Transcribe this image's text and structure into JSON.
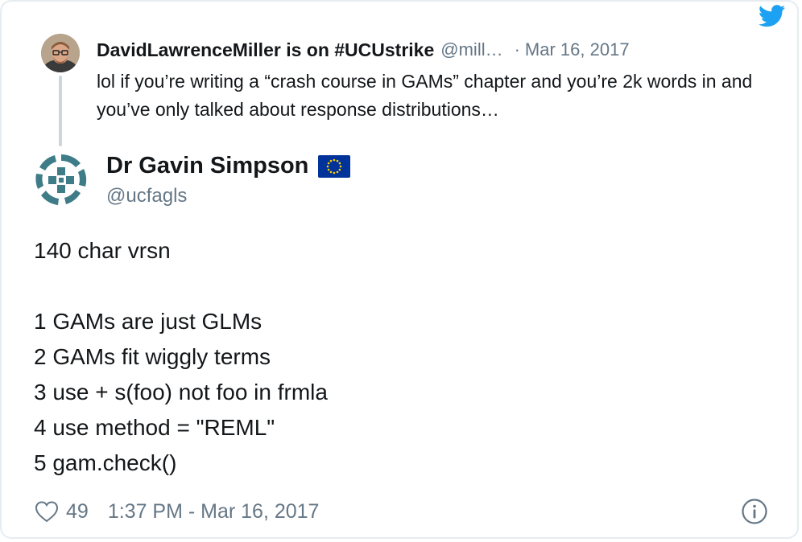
{
  "parent_tweet": {
    "author_name": "DavidLawrenceMiller is on #UCUstrike",
    "handle": "@mill…",
    "separator": "·",
    "date": "Mar 16, 2017",
    "text": "lol if you’re writing a “crash course in GAMs” chapter and you’re 2k words in and you’ve only talked about response distributions…"
  },
  "main_tweet": {
    "author_name": "Dr Gavin Simpson",
    "handle": "@ucfagls",
    "lines": [
      "140 char vrsn",
      "",
      "1 GAMs are just GLMs",
      "2 GAMs fit wiggly terms",
      "3 use + s(foo) not foo in frmla",
      "4 use method = \"REML\"",
      "5 gam.check()"
    ],
    "likes": "49",
    "timestamp": "1:37 PM - Mar 16, 2017"
  },
  "icons": {
    "brand": "twitter-bird-icon",
    "flag": "eu-flag-icon",
    "like": "heart-icon",
    "info": "info-icon"
  },
  "colors": {
    "twitter_blue": "#1da1f2",
    "secondary_text": "#657786",
    "primary_text": "#14171a",
    "thread_line": "#ccd6dd",
    "eu_blue": "#003399",
    "eu_gold": "#ffcc00",
    "avatar_teal": "#3e7c87"
  }
}
